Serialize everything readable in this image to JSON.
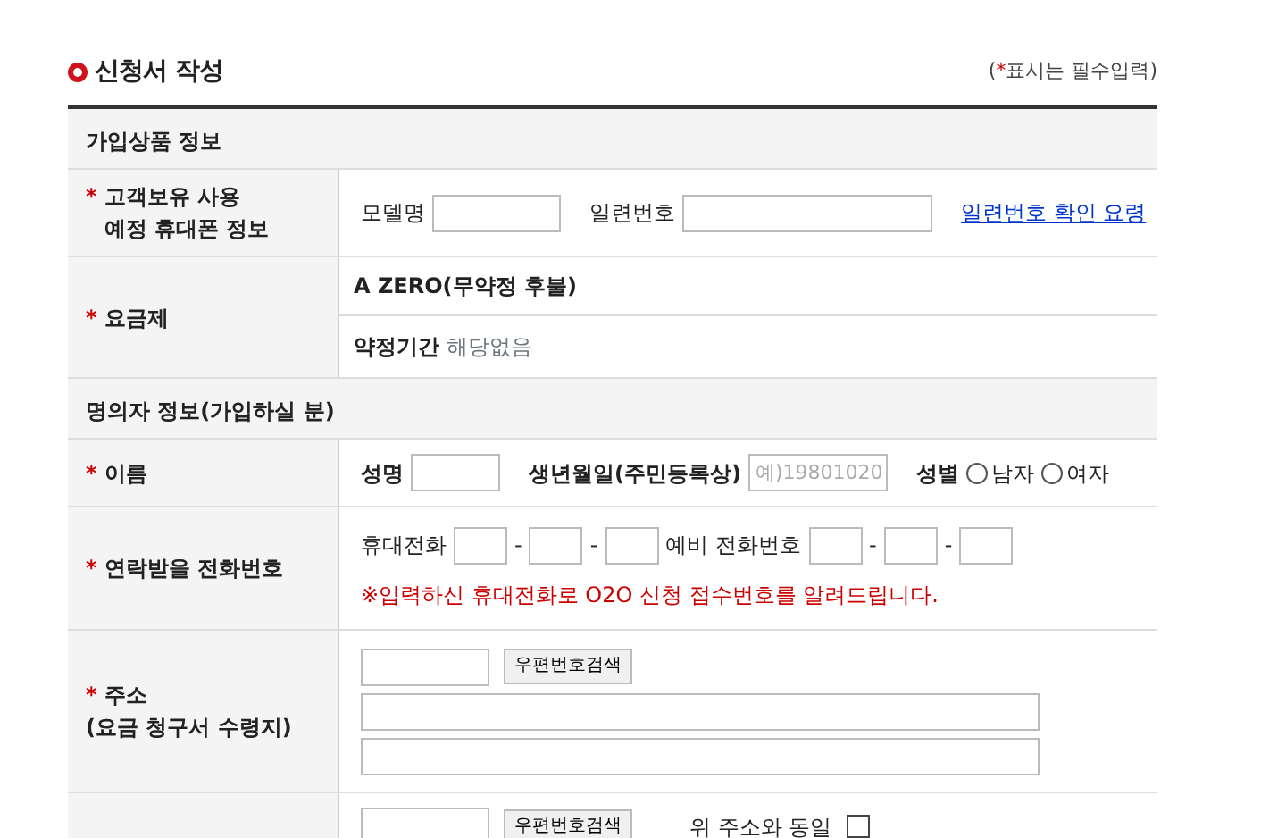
{
  "title": "신청서 작성",
  "note": {
    "open": "(",
    "mark": "*",
    "text": "표시는 필수입력)"
  },
  "sections": [
    {
      "heading": "가입상품 정보",
      "rows": [
        {
          "kind": "device",
          "label": {
            "mark": "*",
            "lines": [
              "고객보유 사용",
              "예정 휴대폰 정보"
            ],
            "hanging": true
          },
          "model_label": "모델명",
          "serial_label": "일련번호",
          "link": "일련번호 확인 요령"
        },
        {
          "kind": "plan",
          "label": {
            "mark": "*",
            "lines": [
              "요금제"
            ]
          },
          "plan": "A ZERO(무약정 후불)",
          "term_label": "약정기간",
          "term_value": "해당없음"
        }
      ]
    },
    {
      "heading": "명의자 정보(가입하실 분)",
      "rows": [
        {
          "kind": "name",
          "label": {
            "mark": "*",
            "lines": [
              "이름"
            ]
          },
          "name_label": "성명",
          "birth_label": "생년월일(주민등록상)",
          "birth_placeholder": "예)19801020",
          "gender_label": "성별",
          "options": [
            {
              "label": "남자",
              "selected": false
            },
            {
              "label": "여자",
              "selected": false
            }
          ]
        },
        {
          "kind": "phone",
          "label": {
            "mark": "*",
            "lines": [
              "연락받을 전화번호"
            ]
          },
          "groups": [
            {
              "label": "휴대전화",
              "separators": [
                "-",
                "-"
              ]
            },
            {
              "label": "예비 전화번호",
              "separators": [
                "-",
                "-"
              ]
            }
          ],
          "notice": "※입력하신 휴대전화로 O2O 신청 접수번호를 알려드립니다."
        },
        {
          "kind": "address",
          "label": {
            "mark": "*",
            "lines": [
              "주소",
              "(요금 청구서 수령지)"
            ],
            "hanging": false
          },
          "button": "우편번호검색"
        },
        {
          "kind": "address2",
          "button": "우편번호검색",
          "same_label": "위 주소와 동일",
          "checked": false
        }
      ]
    }
  ]
}
